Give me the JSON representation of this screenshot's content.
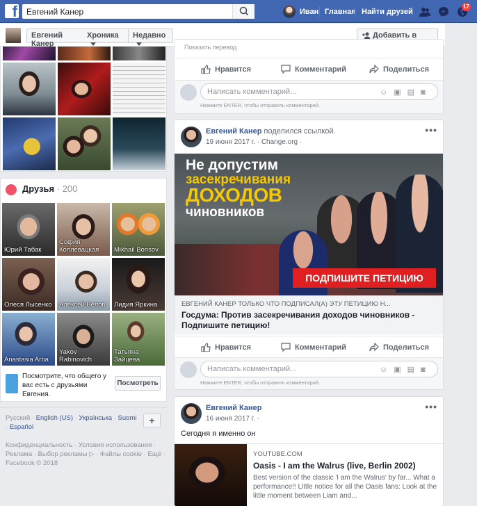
{
  "topbar": {
    "search_value": "Евгений Канер",
    "user_name": "Иван",
    "home_label": "Главная",
    "find_friends_label": "Найти друзей",
    "notifications_count": "17",
    "brand_color": "#4267b2"
  },
  "subbar": {
    "profile_name": "Евгений Канер",
    "timeline_label": "Хроника",
    "recent_label": "Недавно",
    "add_friend_label": "Добавить в друзья"
  },
  "friends": {
    "title": "Друзья",
    "count": "· 200",
    "tiles": [
      {
        "name": "Юрий Табак"
      },
      {
        "name": "София Коплевацкая"
      },
      {
        "name": "Mikhail Borisov"
      },
      {
        "name": "Олеся Лысенко"
      },
      {
        "name": "Алексей Белов"
      },
      {
        "name": "Лидия Яркина"
      },
      {
        "name": "Anastasia Arba"
      },
      {
        "name": "Yakov Rabinovich"
      },
      {
        "name": "Татьяна Зайцева"
      }
    ],
    "mutual_text": "Посмотрите, что общего у вас есть с друзьями Евгения.",
    "mutual_button": "Посмотреть"
  },
  "languages": {
    "items": [
      "Русский",
      "English (US)",
      "Українська",
      "Suomi",
      "Español"
    ],
    "add_label": "+"
  },
  "footer": {
    "line1": "Конфиденциальность · Условия использования ·",
    "line2": "Реклама · Выбор рекламы ▷ · Файлы cookie · Ещё ·",
    "copyright": "Facebook © 2018"
  },
  "post_actions": {
    "like": "Нравится",
    "comment": "Комментарий",
    "share": "Поделиться",
    "comment_placeholder": "Написать комментарий...",
    "enter_hint": "Нажмите ENTER, чтобы отправить комментарий."
  },
  "post_top_partial": {
    "cut_text": "Показать перевод"
  },
  "post_petition": {
    "author": "Евгений Канер",
    "action": " поделился ссылкой.",
    "date": "19 июня 2017 г. · Change.org ·",
    "banner_line1": "Не допустим",
    "banner_line2": "засекречивания",
    "banner_line3": "ДОХОДОВ",
    "banner_line4": "чиновников",
    "banner_button": "ПОДПИШИТЕ ПЕТИЦИЮ",
    "link_source": "ЕВГЕНИЙ КАНЕР ТОЛЬКО ЧТО ПОДПИСАЛ(А) ЭТУ ПЕТИЦИЮ Н...",
    "link_title": "Госдума: Против засекречивания доходов чиновников - Подпишите петицию!"
  },
  "post_youtube": {
    "author": "Евгений Канер",
    "date": "16 июня 2017 г. ·",
    "text": "Сегодня я именно он",
    "source": "YOUTUBE.COM",
    "title": "Oasis - I am the Walrus (live, Berlin 2002)",
    "description": "Best version of the classic 'I am the Walrus' by far... What a performance!! Little notice for all the Oasis fans: Look at the little moment between Liam and..."
  }
}
